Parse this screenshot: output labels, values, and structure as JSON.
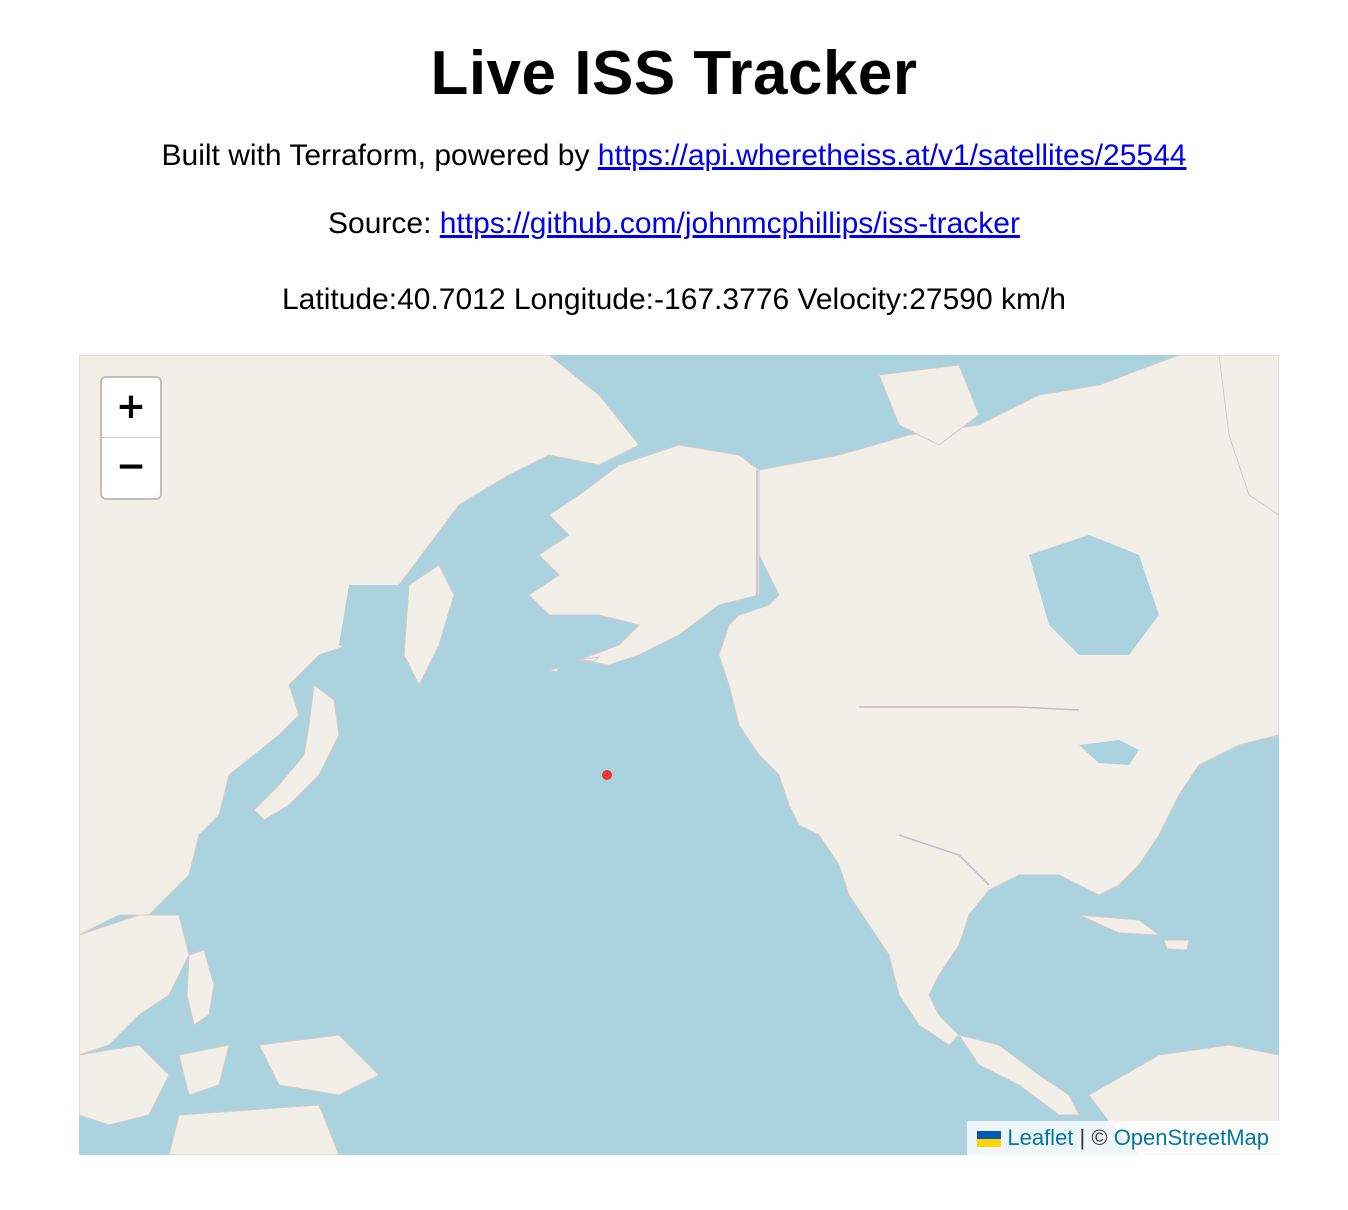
{
  "header": {
    "title": "Live ISS Tracker",
    "built_with_text": "Built with Terraform, powered by ",
    "api_link": "https://api.wheretheiss.at/v1/satellites/25544",
    "source_label": "Source: ",
    "source_link": "https://github.com/johnmcphillips/iss-tracker"
  },
  "telemetry": {
    "latitude_label": "Latitude:",
    "latitude": "40.7012",
    "longitude_label": "Longitude:",
    "longitude": "-167.3776",
    "velocity_label": "Velocity:",
    "velocity": "27590 km/h"
  },
  "map": {
    "zoom_in_label": "+",
    "zoom_out_label": "−",
    "attribution_leaflet": "Leaflet",
    "attribution_sep": " | © ",
    "attribution_osm": "OpenStreetMap",
    "ocean_color": "#aad3df",
    "land_color": "#f2efe9",
    "marker_color": "#e5372c",
    "link_color": "#0078a8"
  }
}
